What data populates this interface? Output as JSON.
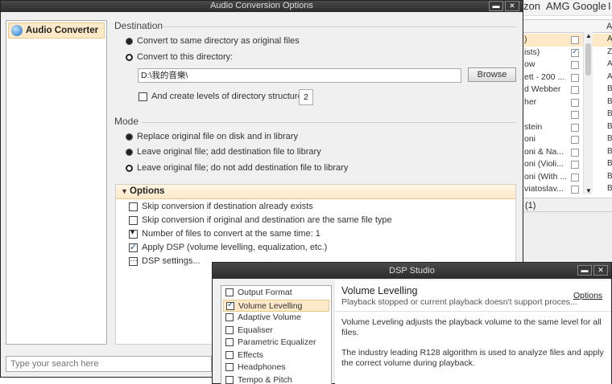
{
  "background_app": {
    "toolbar": [
      "zon",
      "AMG",
      "Google",
      "I"
    ],
    "column_header": "A",
    "rows": [
      {
        "text": ")",
        "checked": false,
        "right": "A",
        "selected": true
      },
      {
        "text": "ists)",
        "checked": true,
        "right": "Z",
        "selected": false
      },
      {
        "text": "ow",
        "checked": false,
        "right": "A",
        "selected": false
      },
      {
        "text": "ett - 200 ...",
        "checked": false,
        "right": "A",
        "selected": false
      },
      {
        "text": "d Webber",
        "checked": false,
        "right": "B",
        "selected": false
      },
      {
        "text": "her",
        "checked": false,
        "right": "B",
        "selected": false
      },
      {
        "text": "",
        "checked": false,
        "right": "B",
        "selected": false
      },
      {
        "text": "stein",
        "checked": false,
        "right": "B",
        "selected": false
      },
      {
        "text": "oni",
        "checked": false,
        "right": "B",
        "selected": false
      },
      {
        "text": "oni & Na...",
        "checked": false,
        "right": "B",
        "selected": false
      },
      {
        "text": "oni (Violi...",
        "checked": false,
        "right": "B",
        "selected": false
      },
      {
        "text": "oni (With ...",
        "checked": false,
        "right": "B",
        "selected": false
      },
      {
        "text": "viatoslav...",
        "checked": false,
        "right": "B",
        "selected": false
      }
    ],
    "status": "(1)"
  },
  "conversion_window": {
    "title": "Audio Conversion Options",
    "left_item": "Audio Converter",
    "search_placeholder": "Type your search here",
    "destination": {
      "header": "Destination",
      "opt_same": "Convert to same directory as original files",
      "opt_this": "Convert to this directory:",
      "selected": "this",
      "directory": "D:\\我的音樂\\",
      "browse": "Browse",
      "create_label": "And create  levels of directory structure",
      "create_checked": false,
      "levels": "2"
    },
    "mode": {
      "header": "Mode",
      "opt_replace": "Replace original file on disk and in library",
      "opt_leave_add": "Leave original file; add destination file to library",
      "opt_leave_no_add": "Leave original file; do not add destination file to library",
      "selected": "leave_no_add"
    },
    "options": {
      "header": "Options",
      "skip_exists": {
        "label": "Skip conversion if destination already exists",
        "checked": false
      },
      "skip_same": {
        "label": "Skip conversion if original and destination are the same file type",
        "checked": false
      },
      "num_files": {
        "label": "Number of files to convert at the same time: 1"
      },
      "apply_dsp": {
        "label": "Apply DSP (volume levelling, equalization, etc.)",
        "checked": true
      },
      "dsp_settings": {
        "label": "DSP settings..."
      }
    }
  },
  "dsp_window": {
    "title": "DSP Studio",
    "items": [
      {
        "label": "Output Format",
        "checked": false,
        "selected": false
      },
      {
        "label": "Volume Levelling",
        "checked": true,
        "selected": true
      },
      {
        "label": "Adaptive Volume",
        "checked": false,
        "selected": false
      },
      {
        "label": "Equaliser",
        "checked": false,
        "selected": false
      },
      {
        "label": "Parametric Equalizer",
        "checked": false,
        "selected": false
      },
      {
        "label": "Effects",
        "checked": false,
        "selected": false
      },
      {
        "label": "Headphones",
        "checked": false,
        "selected": false
      },
      {
        "label": "Tempo & Pitch",
        "checked": false,
        "selected": false
      }
    ],
    "detail": {
      "heading": "Volume Levelling",
      "status": "Playback stopped or current playback doesn't support proces...",
      "options_link": "Options",
      "para1": "Volume Leveling adjusts the playback volume to the same level for all files.",
      "para2": "The industry leading R128 algorithm is used to analyze files and apply the correct volume during playback."
    }
  }
}
